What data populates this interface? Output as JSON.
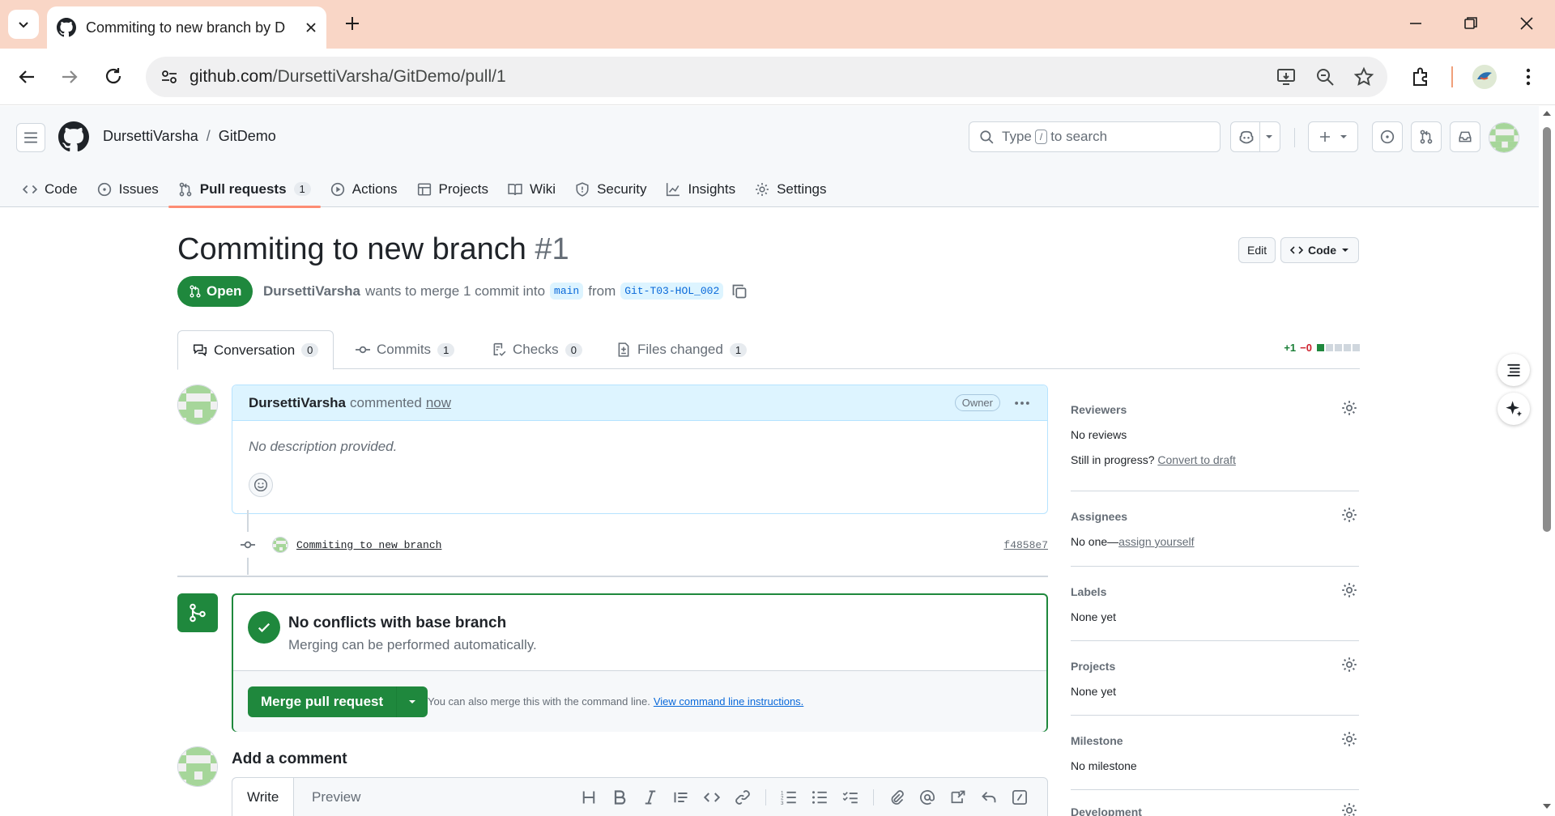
{
  "browser": {
    "tab_title": "Commiting to new branch by D",
    "url_host": "github.com",
    "url_path": "/DursettiVarsha/GitDemo/pull/1"
  },
  "header": {
    "owner": "DursettiVarsha",
    "separator": "/",
    "repo": "GitDemo",
    "search_prefix": "Type",
    "search_key": "/",
    "search_suffix": "to search"
  },
  "repo_nav": [
    {
      "label": "Code",
      "icon": "code-icon"
    },
    {
      "label": "Issues",
      "icon": "issue-icon"
    },
    {
      "label": "Pull requests",
      "icon": "pull-request-icon",
      "count": "1",
      "active": true
    },
    {
      "label": "Actions",
      "icon": "play-icon"
    },
    {
      "label": "Projects",
      "icon": "table-icon"
    },
    {
      "label": "Wiki",
      "icon": "book-icon"
    },
    {
      "label": "Security",
      "icon": "shield-icon"
    },
    {
      "label": "Insights",
      "icon": "graph-icon"
    },
    {
      "label": "Settings",
      "icon": "gear-icon"
    }
  ],
  "pr": {
    "title": "Commiting to new branch",
    "number": "#1",
    "edit_label": "Edit",
    "code_label": "Code",
    "state": "Open",
    "author": "DursettiVarsha",
    "meta_text": "wants to merge 1 commit into",
    "base_branch": "main",
    "from_text": "from",
    "head_branch": "Git-T03-HOL_002"
  },
  "pr_tabs": [
    {
      "label": "Conversation",
      "count": "0"
    },
    {
      "label": "Commits",
      "count": "1"
    },
    {
      "label": "Checks",
      "count": "0"
    },
    {
      "label": "Files changed",
      "count": "1"
    }
  ],
  "diffstat": {
    "additions": "+1",
    "deletions": "−0"
  },
  "comment": {
    "author": "DursettiVarsha",
    "action": "commented",
    "time": "now",
    "badge": "Owner",
    "body": "No description provided."
  },
  "commit": {
    "message": "Commiting to new branch",
    "sha": "f4858e7"
  },
  "merge": {
    "title": "No conflicts with base branch",
    "subtitle": "Merging can be performed automatically.",
    "button": "Merge pull request",
    "note": "You can also merge this with the command line.",
    "link": "View command line instructions."
  },
  "add_comment": {
    "title": "Add a comment",
    "write_tab": "Write",
    "preview_tab": "Preview"
  },
  "sidebar": {
    "reviewers": {
      "heading": "Reviewers",
      "value": "No reviews",
      "progress_text": "Still in progress?",
      "progress_link": "Convert to draft"
    },
    "assignees": {
      "heading": "Assignees",
      "value": "No one—",
      "link": "assign yourself"
    },
    "labels": {
      "heading": "Labels",
      "value": "None yet"
    },
    "projects": {
      "heading": "Projects",
      "value": "None yet"
    },
    "milestone": {
      "heading": "Milestone",
      "value": "No milestone"
    },
    "development": {
      "heading": "Development"
    }
  },
  "colors": {
    "accent_green": "#1f883d",
    "link_blue": "#0969da",
    "tab_underline": "#fd8c73",
    "chrome_tab_strip": "#f9d6c6"
  }
}
